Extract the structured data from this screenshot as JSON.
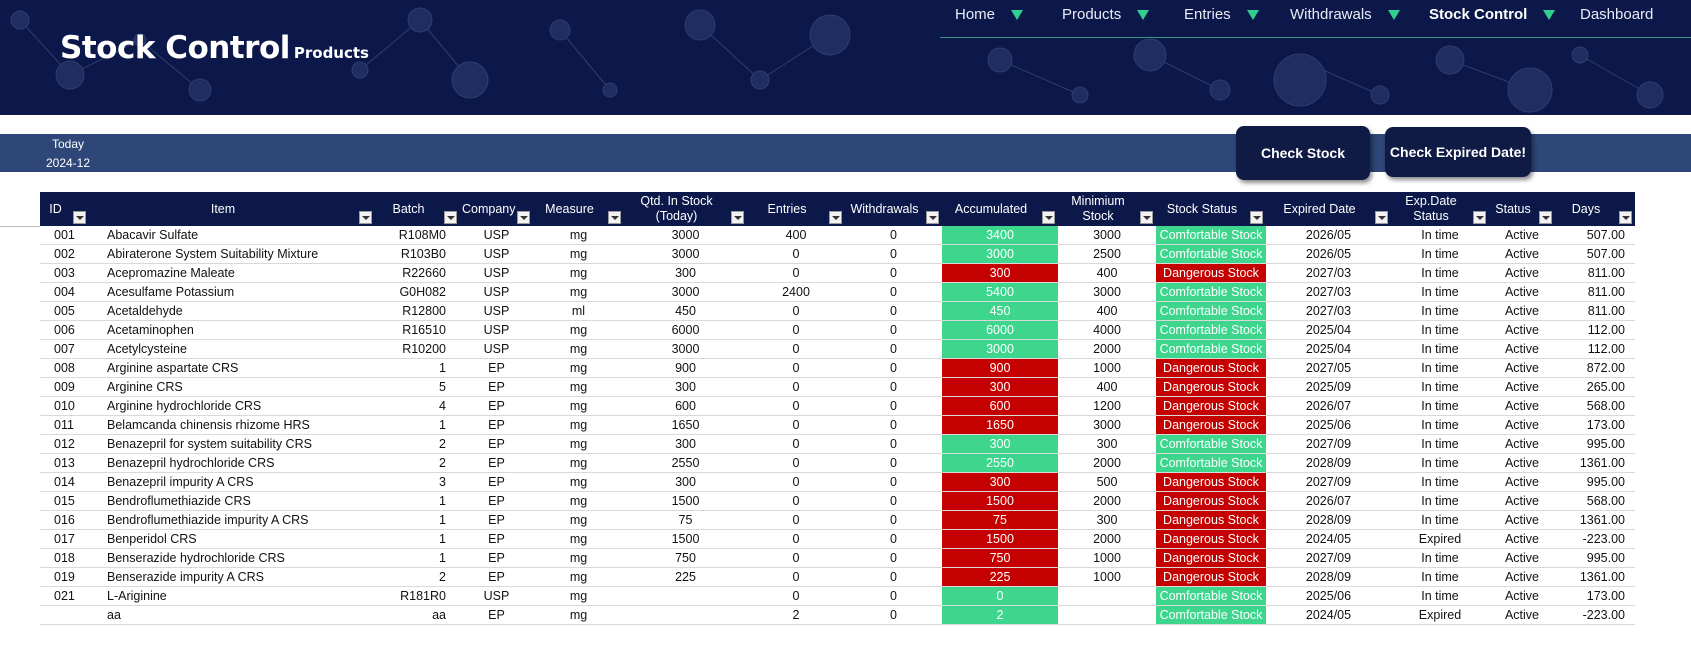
{
  "brand": {
    "title": "Stock Control",
    "subtitle": "Products"
  },
  "nav": [
    {
      "label": "Home"
    },
    {
      "label": "Products"
    },
    {
      "label": "Entries"
    },
    {
      "label": "Withdrawals"
    },
    {
      "label": "Stock Control",
      "active": true
    },
    {
      "label": "Dashboard"
    }
  ],
  "today": {
    "label": "Today",
    "value": "2024-12"
  },
  "buttons": {
    "check_stock": "Check Stock",
    "check_expired": "Check Expired Date!"
  },
  "colors": {
    "banner": "#0c1849",
    "accent": "#2fd08f",
    "comfortable": "#3dd68c",
    "dangerous": "#c40000"
  },
  "table": {
    "headers": [
      "ID",
      "Item",
      "Batch",
      "Company",
      "Measure",
      "Qtd. In Stock (Today)",
      "Entries",
      "Withdrawals",
      "Accumulated",
      "Minimium Stock",
      "Stock Status",
      "Expired Date",
      "Exp.Date Status",
      "Status",
      "Days"
    ],
    "rows": [
      [
        "001",
        "Abacavir Sulfate",
        "R108M0",
        "USP",
        "mg",
        "3000",
        "400",
        "0",
        "3400",
        "3000",
        "Comfortable Stock",
        "2026/05",
        "In time",
        "Active",
        "507.00"
      ],
      [
        "002",
        "Abiraterone System Suitability Mixture",
        "R103B0",
        "USP",
        "mg",
        "3000",
        "0",
        "0",
        "3000",
        "2500",
        "Comfortable Stock",
        "2026/05",
        "In time",
        "Active",
        "507.00"
      ],
      [
        "003",
        "Acepromazine Maleate",
        "R22660",
        "USP",
        "mg",
        "300",
        "0",
        "0",
        "300",
        "400",
        "Dangerous Stock",
        "2027/03",
        "In time",
        "Active",
        "811.00"
      ],
      [
        "004",
        "Acesulfame Potassium",
        "G0H082",
        "USP",
        "mg",
        "3000",
        "2400",
        "0",
        "5400",
        "3000",
        "Comfortable Stock",
        "2027/03",
        "In time",
        "Active",
        "811.00"
      ],
      [
        "005",
        "Acetaldehyde",
        "R12800",
        "USP",
        "ml",
        "450",
        "0",
        "0",
        "450",
        "400",
        "Comfortable Stock",
        "2027/03",
        "In time",
        "Active",
        "811.00"
      ],
      [
        "006",
        "Acetaminophen",
        "R16510",
        "USP",
        "mg",
        "6000",
        "0",
        "0",
        "6000",
        "4000",
        "Comfortable Stock",
        "2025/04",
        "In time",
        "Active",
        "112.00"
      ],
      [
        "007",
        "Acetylcysteine",
        "R10200",
        "USP",
        "mg",
        "3000",
        "0",
        "0",
        "3000",
        "2000",
        "Comfortable Stock",
        "2025/04",
        "In time",
        "Active",
        "112.00"
      ],
      [
        "008",
        "Arginine aspartate CRS",
        "1",
        "EP",
        "mg",
        "900",
        "0",
        "0",
        "900",
        "1000",
        "Dangerous Stock",
        "2027/05",
        "In time",
        "Active",
        "872.00"
      ],
      [
        "009",
        "Arginine CRS",
        "5",
        "EP",
        "mg",
        "300",
        "0",
        "0",
        "300",
        "400",
        "Dangerous Stock",
        "2025/09",
        "In time",
        "Active",
        "265.00"
      ],
      [
        "010",
        "Arginine hydrochloride CRS",
        "4",
        "EP",
        "mg",
        "600",
        "0",
        "0",
        "600",
        "1200",
        "Dangerous Stock",
        "2026/07",
        "In time",
        "Active",
        "568.00"
      ],
      [
        "011",
        "Belamcanda chinensis rhizome HRS",
        "1",
        "EP",
        "mg",
        "1650",
        "0",
        "0",
        "1650",
        "3000",
        "Dangerous Stock",
        "2025/06",
        "In time",
        "Active",
        "173.00"
      ],
      [
        "012",
        "Benazepril for system suitability CRS",
        "2",
        "EP",
        "mg",
        "300",
        "0",
        "0",
        "300",
        "300",
        "Comfortable Stock",
        "2027/09",
        "In time",
        "Active",
        "995.00"
      ],
      [
        "013",
        "Benazepril hydrochloride CRS",
        "2",
        "EP",
        "mg",
        "2550",
        "0",
        "0",
        "2550",
        "2000",
        "Comfortable Stock",
        "2028/09",
        "In time",
        "Active",
        "1361.00"
      ],
      [
        "014",
        "Benazepril impurity A CRS",
        "3",
        "EP",
        "mg",
        "300",
        "0",
        "0",
        "300",
        "500",
        "Dangerous Stock",
        "2027/09",
        "In time",
        "Active",
        "995.00"
      ],
      [
        "015",
        "Bendroflumethiazide CRS",
        "1",
        "EP",
        "mg",
        "1500",
        "0",
        "0",
        "1500",
        "2000",
        "Dangerous Stock",
        "2026/07",
        "In time",
        "Active",
        "568.00"
      ],
      [
        "016",
        "Bendroflumethiazide impurity A CRS",
        "1",
        "EP",
        "mg",
        "75",
        "0",
        "0",
        "75",
        "300",
        "Dangerous Stock",
        "2028/09",
        "In time",
        "Active",
        "1361.00"
      ],
      [
        "017",
        "Benperidol CRS",
        "1",
        "EP",
        "mg",
        "1500",
        "0",
        "0",
        "1500",
        "2000",
        "Dangerous Stock",
        "2024/05",
        "Expired",
        "Active",
        "-223.00"
      ],
      [
        "018",
        "Benserazide hydrochloride CRS",
        "1",
        "EP",
        "mg",
        "750",
        "0",
        "0",
        "750",
        "1000",
        "Dangerous Stock",
        "2027/09",
        "In time",
        "Active",
        "995.00"
      ],
      [
        "019",
        "Benserazide impurity A CRS",
        "2",
        "EP",
        "mg",
        "225",
        "0",
        "0",
        "225",
        "1000",
        "Dangerous Stock",
        "2028/09",
        "In time",
        "Active",
        "1361.00"
      ],
      [
        "021",
        "L-Ariginine",
        "R181R0",
        "USP",
        "mg",
        "",
        "0",
        "0",
        "0",
        "",
        "Comfortable Stock",
        "2025/06",
        "In time",
        "Active",
        "173.00"
      ],
      [
        "",
        "aa",
        "aa",
        "EP",
        "mg",
        "",
        "2",
        "0",
        "2",
        "",
        "Comfortable Stock",
        "2024/05",
        "Expired",
        "Active",
        "-223.00"
      ]
    ]
  }
}
